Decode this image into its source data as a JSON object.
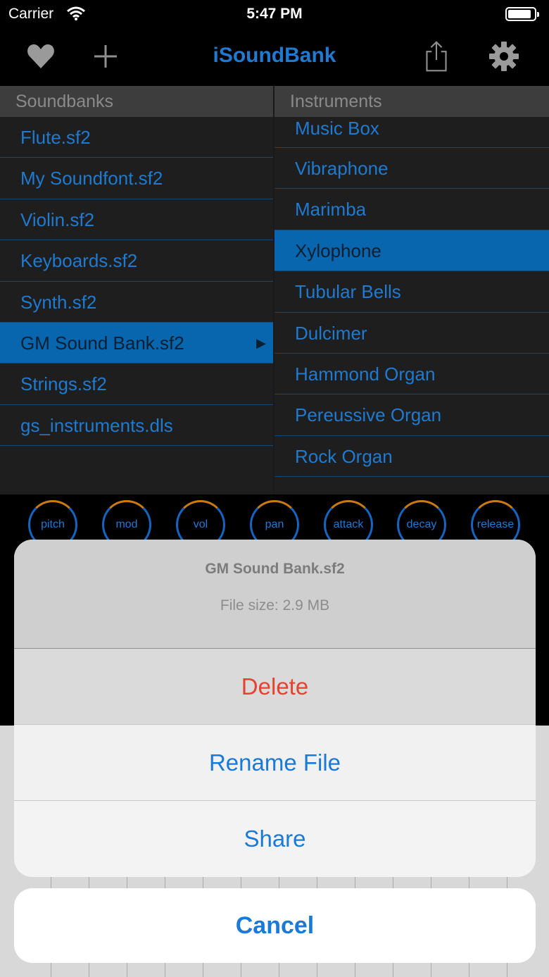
{
  "status": {
    "carrier": "Carrier",
    "time": "5:47 PM"
  },
  "nav": {
    "title": "iSoundBank"
  },
  "columns": {
    "soundbanks_header": "Soundbanks",
    "instruments_header": "Instruments"
  },
  "soundbanks": [
    "Flute.sf2",
    "My Soundfont.sf2",
    "Violin.sf2",
    "Keyboards.sf2",
    "Synth.sf2",
    "GM Sound Bank.sf2",
    "Strings.sf2",
    "gs_instruments.dls"
  ],
  "instruments": [
    "Music Box",
    "Vibraphone",
    "Marimba",
    "Xylophone",
    "Tubular Bells",
    "Dulcimer",
    "Hammond Organ",
    "Pereussive Organ",
    "Rock Organ"
  ],
  "knobs": [
    "pitch",
    "mod",
    "vol",
    "pan",
    "attack",
    "decay",
    "release"
  ],
  "action_sheet": {
    "title": "GM Sound Bank.sf2",
    "subtitle": "File size: 2.9 MB",
    "delete_label": "Delete",
    "rename_label": "Rename File",
    "share_label": "Share",
    "cancel_label": "Cancel"
  },
  "colors": {
    "accent": "#1f7ad0",
    "selected": "#0766ad",
    "destructive": "#e8412f"
  },
  "icons": {
    "favorite": "heart-icon",
    "add": "plus-icon",
    "share": "share-icon",
    "settings": "gear-icon"
  }
}
